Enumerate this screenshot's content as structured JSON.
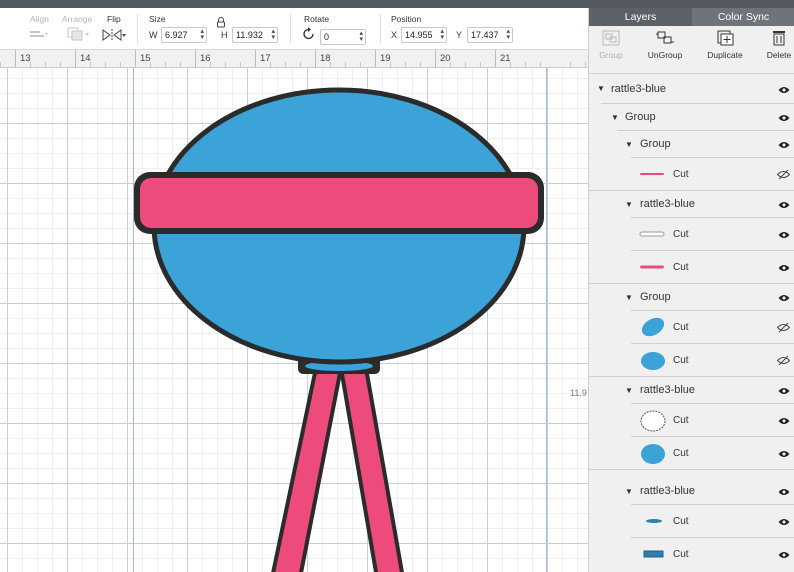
{
  "toolbar": {
    "align_label": "Align",
    "arrange_label": "Arrange",
    "flip_label": "Flip",
    "size_label": "Size",
    "width_letter": "W",
    "width_value": "6.927",
    "height_letter": "H",
    "height_value": "11.932",
    "rotate_label": "Rotate",
    "rotate_value": "0",
    "position_label": "Position",
    "x_letter": "X",
    "x_value": "14.955",
    "y_letter": "Y",
    "y_value": "17.437"
  },
  "ruler": {
    "numbers": [
      "13",
      "14",
      "15",
      "16",
      "17",
      "18",
      "19",
      "20",
      "21"
    ]
  },
  "canvas": {
    "height_readout": "11.9"
  },
  "panel": {
    "tabs": [
      "Layers",
      "Color Sync"
    ],
    "tools": {
      "group": "Group",
      "ungroup": "UnGroup",
      "duplicate": "Duplicate",
      "delete": "Delete"
    },
    "layers": [
      {
        "name": "rattle3-blue"
      },
      {
        "name": "Group"
      },
      {
        "name": "Group"
      },
      {
        "name": "Cut"
      },
      {
        "name": "rattle3-blue"
      },
      {
        "name": "Cut"
      },
      {
        "name": "Cut"
      },
      {
        "name": "Group"
      },
      {
        "name": "Cut"
      },
      {
        "name": "Cut"
      },
      {
        "name": "rattle3-blue"
      },
      {
        "name": "Cut"
      },
      {
        "name": "Cut"
      },
      {
        "name": "rattle3-blue"
      },
      {
        "name": "Cut"
      },
      {
        "name": "Cut"
      }
    ]
  },
  "colors": {
    "blue": "#3ba3d8",
    "pink": "#ee4b7d",
    "outline": "#2b2b2b",
    "panel_tab": "#5c6167"
  }
}
